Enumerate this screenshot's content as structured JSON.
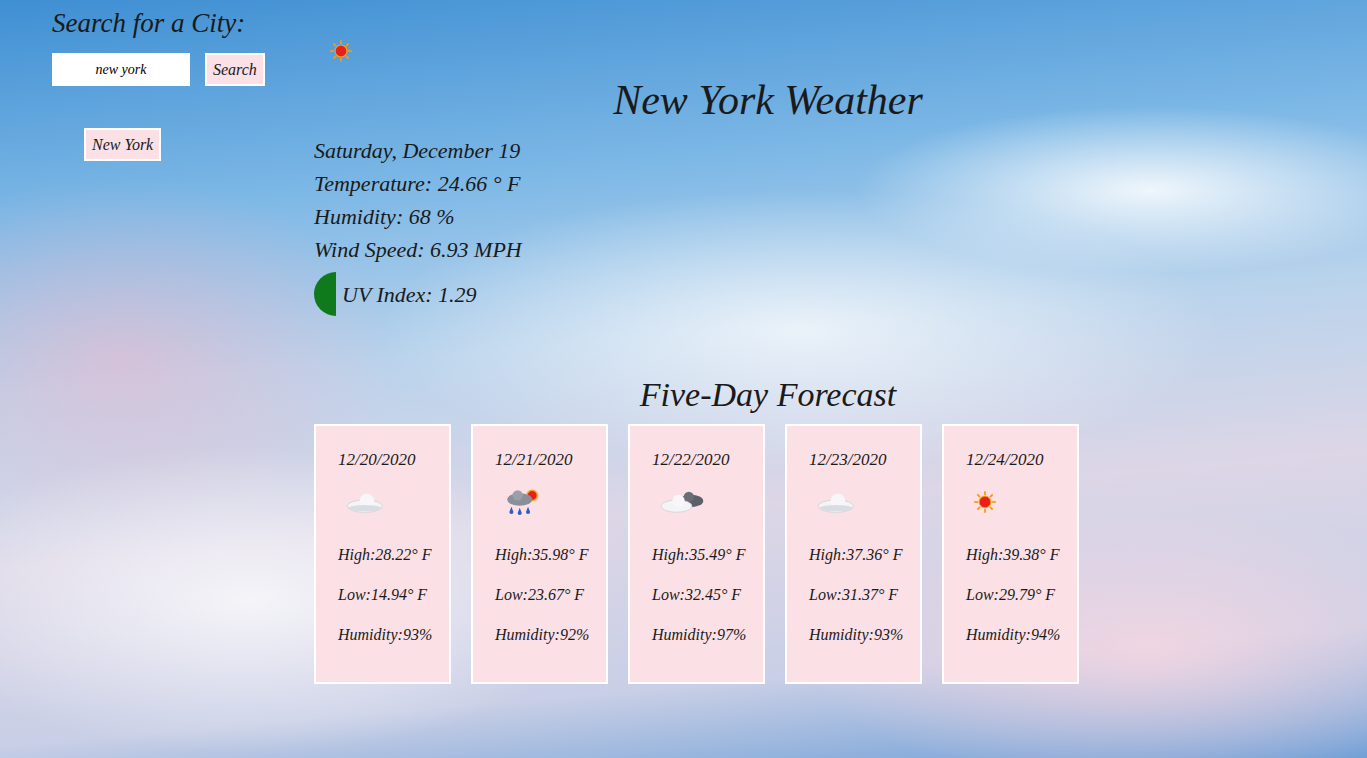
{
  "sidebar": {
    "heading": "Search for a City:",
    "search_value": "new york",
    "search_button": "Search",
    "history": [
      {
        "label": "New York"
      }
    ]
  },
  "current": {
    "icon_kind": "sun",
    "title": "New York Weather",
    "date": "Saturday, December 19",
    "temperature": "Temperature: 24.66 ° F",
    "humidity": "Humidity: 68 %",
    "wind": "Wind Speed: 6.93 MPH",
    "uv": {
      "label": "UV Index: 1.29",
      "color": "#0f7a1c"
    }
  },
  "forecast": {
    "heading": "Five-Day Forecast",
    "days": [
      {
        "date": "12/20/2020",
        "kind": "cloud",
        "high": "High:28.22° F",
        "low": "Low:14.94° F",
        "humidity": "Humidity:93%"
      },
      {
        "date": "12/21/2020",
        "kind": "rain",
        "high": "High:35.98° F",
        "low": "Low:23.67° F",
        "humidity": "Humidity:92%"
      },
      {
        "date": "12/22/2020",
        "kind": "overcast",
        "high": "High:35.49° F",
        "low": "Low:32.45° F",
        "humidity": "Humidity:97%"
      },
      {
        "date": "12/23/2020",
        "kind": "cloud",
        "high": "High:37.36° F",
        "low": "Low:31.37° F",
        "humidity": "Humidity:93%"
      },
      {
        "date": "12/24/2020",
        "kind": "sun",
        "high": "High:39.38° F",
        "low": "Low:29.79° F",
        "humidity": "Humidity:94%"
      }
    ]
  }
}
